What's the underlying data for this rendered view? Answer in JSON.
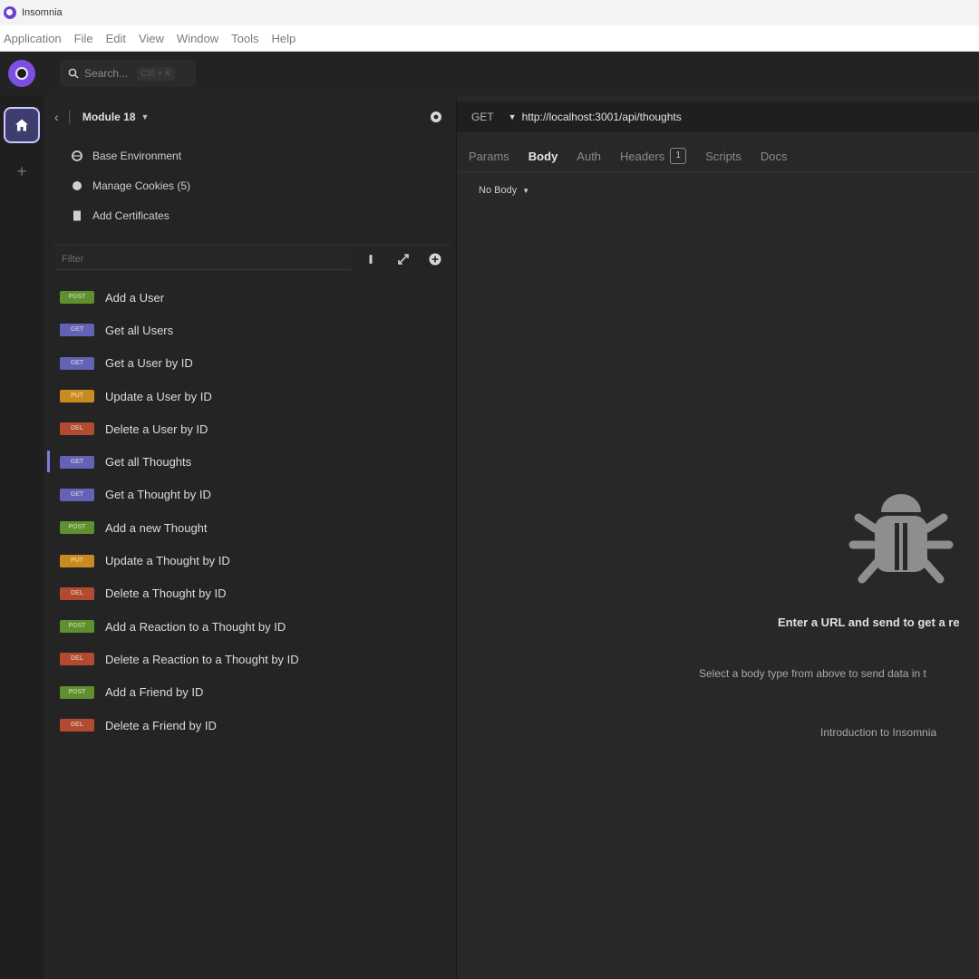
{
  "window": {
    "title": "Insomnia"
  },
  "menu": [
    "Application",
    "File",
    "Edit",
    "View",
    "Window",
    "Tools",
    "Help"
  ],
  "search": {
    "placeholder": "Search...",
    "shortcut": "Ctrl + K"
  },
  "collection": {
    "name": "Module 18"
  },
  "environment_items": [
    {
      "icon": "globe-icon",
      "label": "Base Environment"
    },
    {
      "icon": "cookie-icon",
      "label": "Manage Cookies (5)"
    },
    {
      "icon": "certificate-icon",
      "label": "Add Certificates"
    }
  ],
  "filter": {
    "placeholder": "Filter"
  },
  "requests": [
    {
      "method": "POST",
      "label": "Add a User",
      "color": "#5f8f2e"
    },
    {
      "method": "GET",
      "label": "Get all Users",
      "color": "#6363b5"
    },
    {
      "method": "GET",
      "label": "Get a User by ID",
      "color": "#6363b5"
    },
    {
      "method": "PUT",
      "label": "Update a User by ID",
      "color": "#c98a1e"
    },
    {
      "method": "DEL",
      "label": "Delete a User by ID",
      "color": "#b34a30"
    },
    {
      "method": "GET",
      "label": "Get all Thoughts",
      "color": "#6363b5",
      "active": true
    },
    {
      "method": "GET",
      "label": "Get a Thought by ID",
      "color": "#6363b5"
    },
    {
      "method": "POST",
      "label": "Add a new Thought",
      "color": "#5f8f2e"
    },
    {
      "method": "PUT",
      "label": "Update a Thought by ID",
      "color": "#c98a1e"
    },
    {
      "method": "DEL",
      "label": "Delete a Thought by ID",
      "color": "#b34a30"
    },
    {
      "method": "POST",
      "label": "Add a Reaction to a Thought by ID",
      "color": "#5f8f2e"
    },
    {
      "method": "DEL",
      "label": "Delete a Reaction to a Thought by ID",
      "color": "#b34a30"
    },
    {
      "method": "POST",
      "label": "Add a Friend by ID",
      "color": "#5f8f2e"
    },
    {
      "method": "DEL",
      "label": "Delete a Friend by ID",
      "color": "#b34a30"
    }
  ],
  "request": {
    "method": "GET",
    "url": "http://localhost:3001/api/thoughts"
  },
  "tabs": [
    {
      "label": "Params"
    },
    {
      "label": "Body",
      "active": true
    },
    {
      "label": "Auth"
    },
    {
      "label": "Headers",
      "count": "1"
    },
    {
      "label": "Scripts"
    },
    {
      "label": "Docs"
    }
  ],
  "body_type": {
    "label": "No Body"
  },
  "empty_state": {
    "title": "Enter a URL and send to get a re",
    "hint": "Select a body type from above to send data in t",
    "link": "Introduction to Insomnia"
  },
  "colors": {
    "accent": "#7b4fe0",
    "background": "#2a2a2a",
    "sidebar": "#242424"
  }
}
